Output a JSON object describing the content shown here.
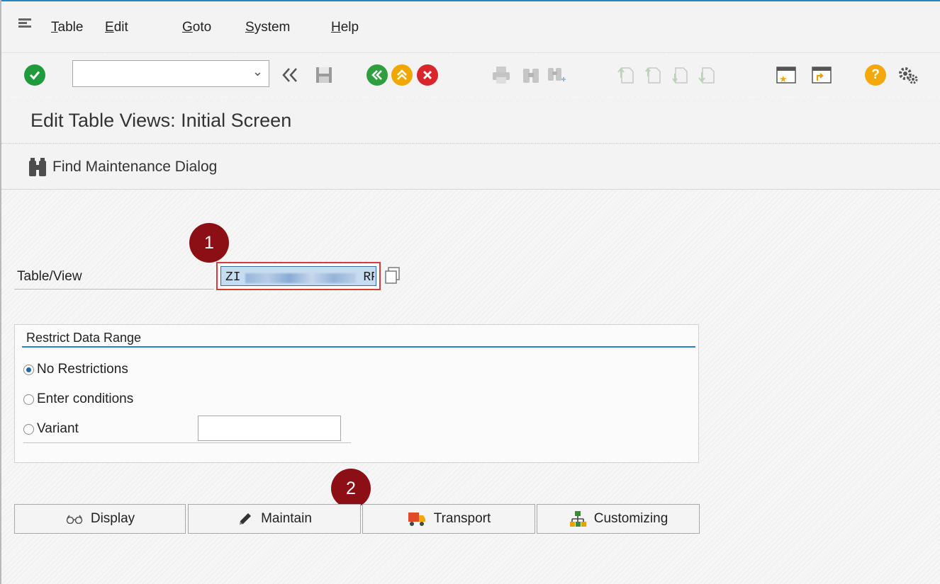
{
  "menu": {
    "items": [
      {
        "first": "T",
        "rest": "able"
      },
      {
        "first": "E",
        "rest": "dit"
      },
      {
        "first": "G",
        "rest": "oto"
      },
      {
        "first": "S",
        "rest": "ystem"
      },
      {
        "first": "H",
        "rest": "elp"
      }
    ]
  },
  "toolbar": {
    "command_field_value": "",
    "icons": [
      "enter-icon",
      "back-double-chevron-icon",
      "save-icon",
      "back-icon",
      "exit-icon",
      "cancel-icon",
      "print-icon",
      "find-icon",
      "find-next-icon",
      "first-page-icon",
      "previous-page-icon",
      "next-page-icon",
      "last-page-icon",
      "create-session-icon",
      "shortcut-icon",
      "help-icon",
      "customize-layout-icon"
    ]
  },
  "title": "Edit Table Views: Initial Screen",
  "app_toolbar": {
    "find_label": "Find Maintenance Dialog"
  },
  "form": {
    "table_view_label": "Table/View",
    "table_view_value": "ZI                RP",
    "badge1": "1",
    "badge2": "2"
  },
  "restrict": {
    "title": "Restrict Data Range",
    "options": [
      {
        "label": "No Restrictions",
        "selected": true
      },
      {
        "label": "Enter conditions",
        "selected": false
      },
      {
        "label": "Variant",
        "selected": false
      }
    ],
    "variant_value": ""
  },
  "buttons": {
    "display": "Display",
    "maintain": "Maintain",
    "transport": "Transport",
    "customizing": "Customizing"
  },
  "colors": {
    "accent": "#1e88c7",
    "badge": "#8b0f15",
    "enter_green": "#1f9a3c",
    "back_green": "#2e9e3e",
    "exit_orange": "#f0a800",
    "cancel_red": "#d9262b",
    "help_yellow": "#f3a80c"
  }
}
